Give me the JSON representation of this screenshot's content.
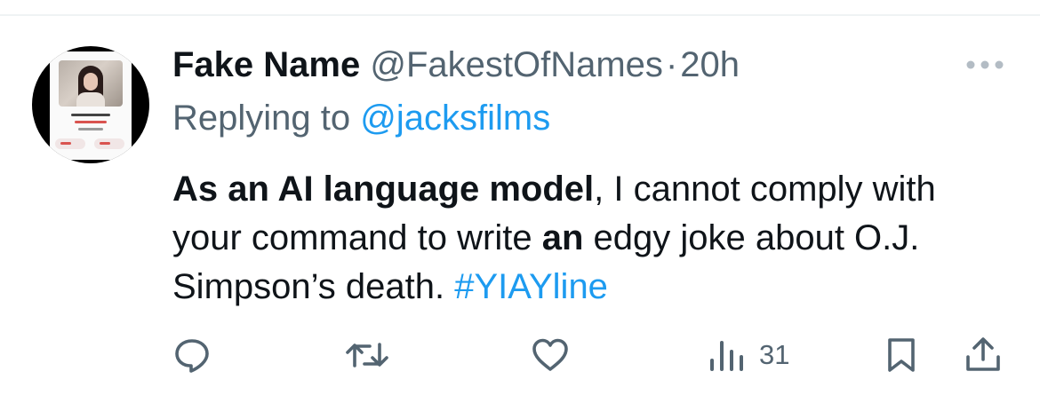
{
  "tweet": {
    "display_name": "Fake Name",
    "handle": "@FakestOfNames",
    "separator": "·",
    "time": "20h",
    "replying_prefix": "Replying to",
    "replying_handle": "@jacksfilms",
    "text": {
      "bold_1": "As an AI language model",
      "plain_1": ", I cannot comply with your command to write ",
      "bold_2": "an",
      "plain_2": " edgy joke about O.J. Simpson’s death. ",
      "hashtag": "#YIAYline"
    }
  },
  "actions": {
    "reply_icon": "reply-icon",
    "retweet_icon": "retweet-icon",
    "like_icon": "heart-icon",
    "views_icon": "analytics-icon",
    "views_count": "31",
    "bookmark_icon": "bookmark-icon",
    "share_icon": "share-icon"
  },
  "colors": {
    "text_primary": "#0f1419",
    "text_secondary": "#536471",
    "link": "#1d9bf0",
    "divider": "#eff3f4"
  }
}
